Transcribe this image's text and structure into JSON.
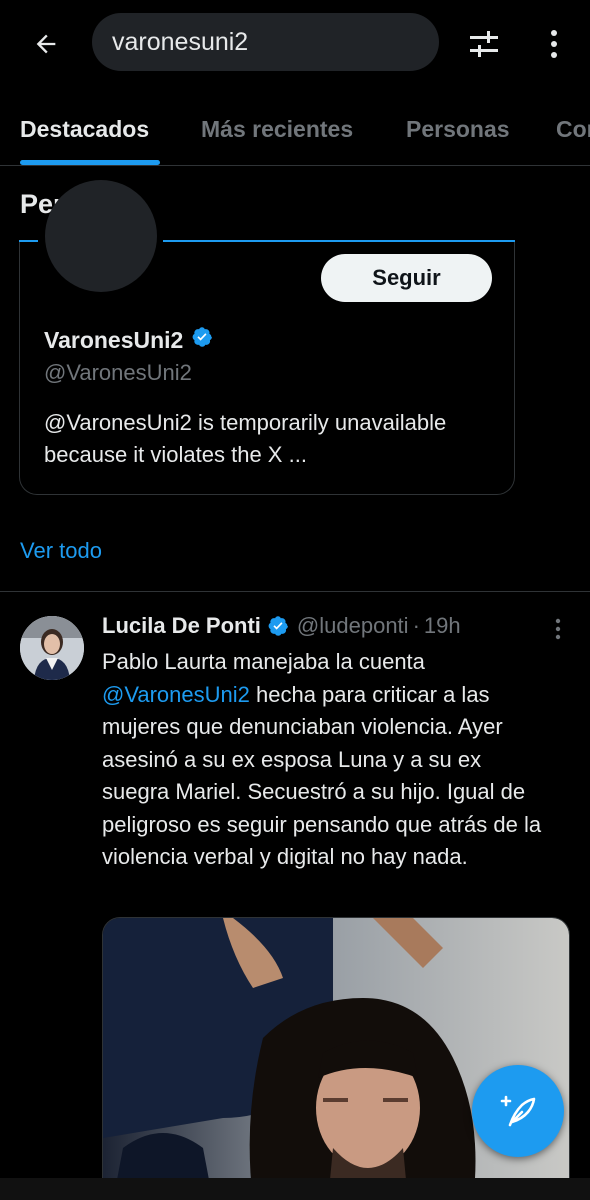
{
  "search": {
    "query": "varonesuni2"
  },
  "tabs": [
    {
      "label": "Destacados",
      "active": true
    },
    {
      "label": "Más recientes",
      "active": false
    },
    {
      "label": "Personas",
      "active": false
    },
    {
      "label": "Con",
      "active": false
    }
  ],
  "people": {
    "section_title": "Personas",
    "card": {
      "name": "VaronesUni2",
      "handle": "@VaronesUni2",
      "bio": "@VaronesUni2 is temporarily unavailable because it violates the X ...",
      "follow_label": "Seguir"
    },
    "see_all": "Ver todo"
  },
  "tweet": {
    "name": "Lucila De Ponti",
    "handle": "@ludeponti",
    "dot": "·",
    "time": "19h",
    "text_before": "Pablo Laurta manejaba la cuenta ",
    "mention": "@VaronesUni2",
    "text_after": " hecha para criticar a las mujeres que denunciaban violencia. Ayer asesinó a su ex esposa Luna y a su ex suegra Mariel. Secuestró a su hijo. Igual de peligroso es seguir pensando que atrás de la violencia verbal y digital no hay nada."
  },
  "colors": {
    "accent": "#1d9bf0",
    "background": "#000000",
    "text_primary": "#e7e9ea",
    "text_secondary": "#71767b"
  },
  "icons": {
    "back": "arrow-left-icon",
    "filter": "sliders-icon",
    "more": "more-vertical-icon",
    "verified": "verified-badge-icon",
    "compose": "compose-feather-icon"
  }
}
